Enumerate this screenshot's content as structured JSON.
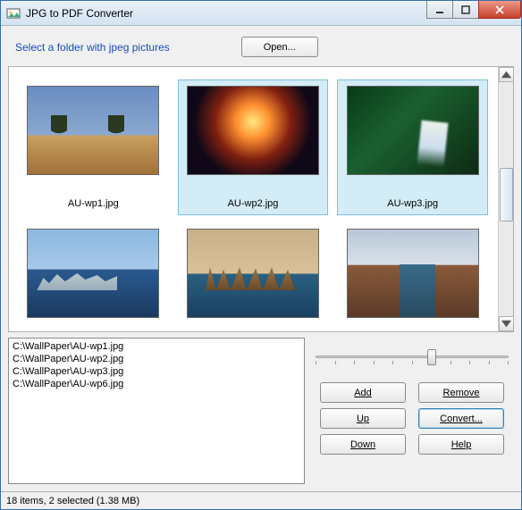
{
  "window": {
    "title": "JPG to PDF Converter"
  },
  "top": {
    "prompt": "Select a folder with jpeg pictures",
    "open": "Open..."
  },
  "thumbs": [
    {
      "name": "AU-wp1.jpg",
      "selected": false
    },
    {
      "name": "AU-wp2.jpg",
      "selected": true
    },
    {
      "name": "AU-wp3.jpg",
      "selected": true
    },
    {
      "name": "",
      "selected": false
    },
    {
      "name": "",
      "selected": false
    },
    {
      "name": "",
      "selected": false
    }
  ],
  "list": [
    "C:\\WallPaper\\AU-wp1.jpg",
    "C:\\WallPaper\\AU-wp2.jpg",
    "C:\\WallPaper\\AU-wp3.jpg",
    "C:\\WallPaper\\AU-wp6.jpg"
  ],
  "buttons": {
    "add": "Add",
    "remove": "Remove",
    "up": "Up",
    "convert": "Convert...",
    "down": "Down",
    "help": "Help"
  },
  "status": "18 items, 2 selected (1.38 MB)"
}
